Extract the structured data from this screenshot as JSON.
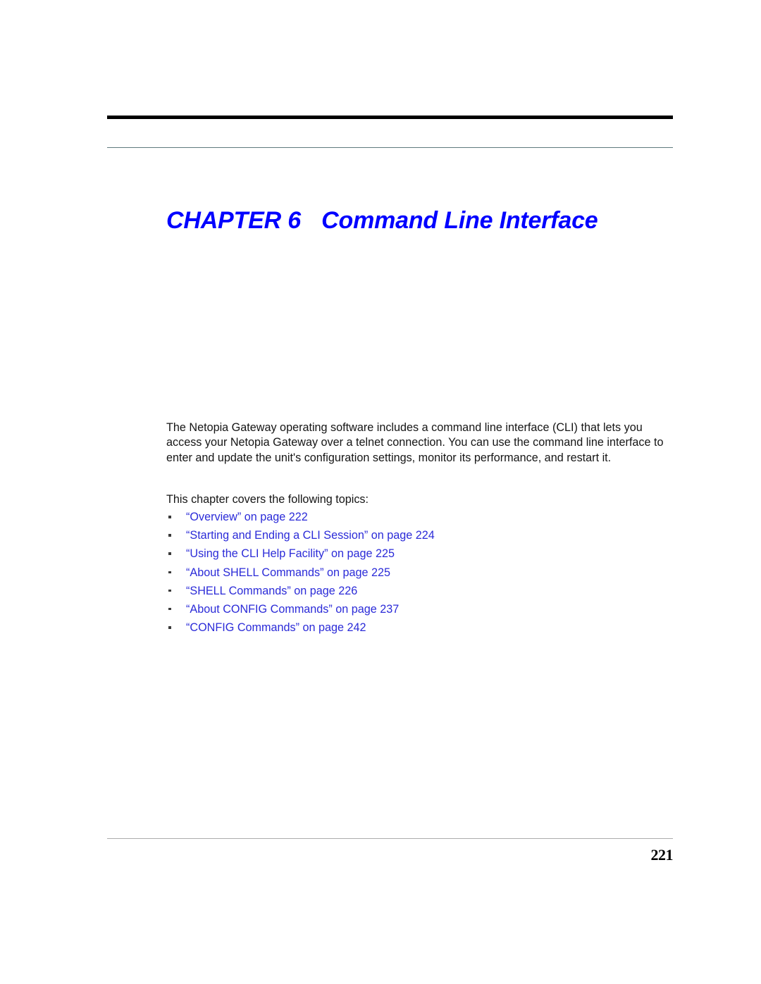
{
  "document": {
    "header_rule_color": "#000000",
    "header_thin_rule_color": "#5f7a7e",
    "footer_rule_color": "#acacac",
    "link_color": "#2b2bd8",
    "title_color": "#0000ff"
  },
  "chapter": {
    "label": "CHAPTER",
    "number": "6",
    "name": "Command Line Interface"
  },
  "body": {
    "intro": "The Netopia Gateway operating software includes a command line interface (CLI) that lets you access your Netopia Gateway over a telnet connection. You can use the command line interface to enter and update the unit's configuration settings, monitor its performance, and restart it.",
    "topics_lead": "This chapter covers the following topics:"
  },
  "topics": [
    {
      "text": "“Overview” on page 222"
    },
    {
      "text": "“Starting and Ending a CLI Session” on page 224"
    },
    {
      "text": "“Using the CLI Help Facility” on page 225"
    },
    {
      "text": "“About SHELL Commands” on page 225"
    },
    {
      "text": "“SHELL Commands” on page 226"
    },
    {
      "text": "“About CONFIG Commands” on page 237"
    },
    {
      "text": "“CONFIG Commands” on page 242"
    }
  ],
  "footer": {
    "page_number": "221"
  }
}
